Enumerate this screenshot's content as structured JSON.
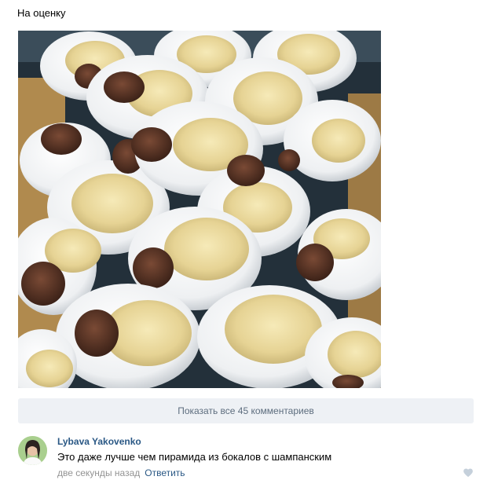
{
  "post": {
    "text": "На оценку"
  },
  "photo": {
    "description_icon": "food-photo"
  },
  "comments_bar": {
    "label": "Показать все 45 комментариев"
  },
  "comment": {
    "author": "Lybava Yakovenko",
    "text": "Это даже лучше чем пирамида из бокалов с шампанским",
    "time": "две секунды назад",
    "reply_label": "Ответить"
  },
  "icons": {
    "like": "heart-icon"
  },
  "colors": {
    "link": "#2a5885",
    "meta": "#939393",
    "bar_bg": "#eef1f5",
    "bar_text": "#5d6d7e",
    "like": "#c5d0db"
  }
}
